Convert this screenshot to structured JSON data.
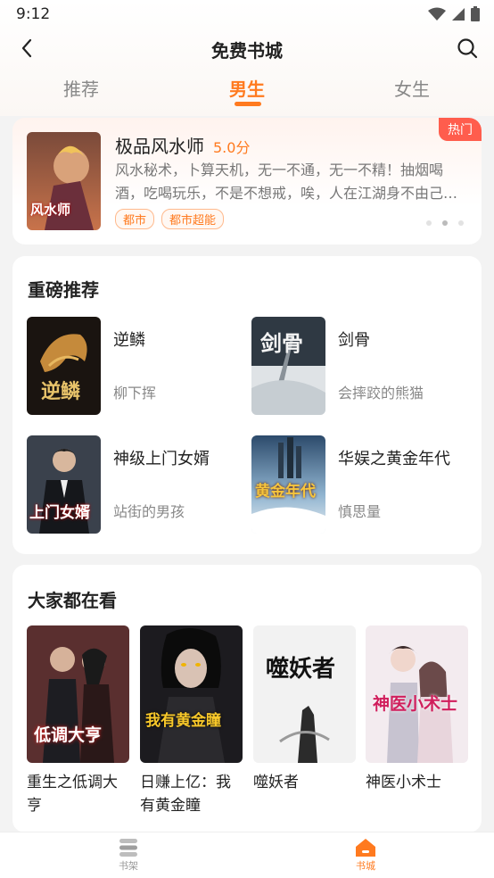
{
  "status_bar": {
    "time": "9:12"
  },
  "header": {
    "title": "免费书城"
  },
  "tabs": [
    {
      "label": "推荐",
      "active": false
    },
    {
      "label": "男生",
      "active": true
    },
    {
      "label": "女生",
      "active": false
    }
  ],
  "hot": {
    "badge": "热门",
    "title": "极品风水师",
    "score": "5.0分",
    "description": "风水秘术，卜算天机，无一不通，无一不精！抽烟喝酒，吃喝玩乐，不是不想戒，唉，人在江湖身不由己…",
    "tags": [
      "都市",
      "都市超能"
    ],
    "cover_text": "风水师",
    "page_index": 1,
    "page_count": 3
  },
  "featured": {
    "title": "重磅推荐",
    "books": [
      {
        "title": "逆鳞",
        "author": "柳下挥",
        "cover_text": "逆鳞"
      },
      {
        "title": "剑骨",
        "author": "会摔跤的熊猫",
        "cover_text": "剑骨"
      },
      {
        "title": "神级上门女婿",
        "author": "站街的男孩",
        "cover_text": "上门女婿"
      },
      {
        "title": "华娱之黄金年代",
        "author": "慎思量",
        "cover_text": "黄金年代"
      }
    ]
  },
  "popular": {
    "title": "大家都在看",
    "books": [
      {
        "title": "重生之低调大亨",
        "cover_text": "低调大亨"
      },
      {
        "title": "日赚上亿：我有黄金瞳",
        "cover_text": "我有黄金瞳"
      },
      {
        "title": "噬妖者",
        "cover_text": "噬妖者"
      },
      {
        "title": "神医小术士",
        "cover_text": "神医小术士"
      }
    ]
  },
  "bottom_nav": [
    {
      "label": "书架",
      "icon": "bookshelf-icon",
      "active": false
    },
    {
      "label": "书城",
      "icon": "home-icon",
      "active": true
    }
  ],
  "colors": {
    "accent": "#ff7a1f",
    "hot_badge": "#ff5d4d"
  }
}
